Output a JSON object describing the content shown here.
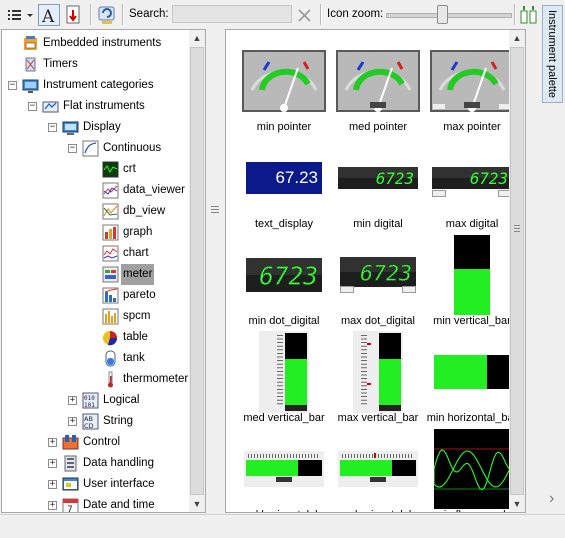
{
  "toolbar": {
    "search_label": "Search:",
    "search_value": "",
    "zoom_label": "Icon zoom:",
    "zoom_level": 0.45,
    "icons": [
      "list-view-icon",
      "font-icon",
      "sort-icon",
      "refresh-icon",
      "clear-icon",
      "palette-layout-icon"
    ]
  },
  "tree": {
    "items": [
      {
        "label": "Embedded instruments",
        "icon": "embedded-instruments-icon"
      },
      {
        "label": "Timers",
        "icon": "timers-icon"
      },
      {
        "label": "Instrument categories",
        "icon": "categories-icon",
        "expander": "-"
      },
      {
        "label": "Flat instruments",
        "icon": "flat-instruments-icon",
        "expander": "-"
      },
      {
        "label": "Display",
        "icon": "display-icon",
        "expander": "-"
      },
      {
        "label": "Continuous",
        "icon": "continuous-icon",
        "expander": "-"
      },
      {
        "label": "crt",
        "icon": "crt-icon"
      },
      {
        "label": "data_viewer",
        "icon": "data-viewer-icon"
      },
      {
        "label": "db_view",
        "icon": "db-view-icon"
      },
      {
        "label": "graph",
        "icon": "graph-icon"
      },
      {
        "label": "chart",
        "icon": "chart-icon"
      },
      {
        "label": "meter",
        "icon": "meter-icon",
        "selected": true
      },
      {
        "label": "pareto",
        "icon": "pareto-icon"
      },
      {
        "label": "spcm",
        "icon": "spcm-icon"
      },
      {
        "label": "table",
        "icon": "table-icon"
      },
      {
        "label": "tank",
        "icon": "tank-icon"
      },
      {
        "label": "thermometer",
        "icon": "thermometer-icon"
      },
      {
        "label": "Logical",
        "icon": "logical-icon",
        "expander": "+"
      },
      {
        "label": "String",
        "icon": "string-icon",
        "expander": "+"
      },
      {
        "label": "Control",
        "icon": "control-icon",
        "expander": "+"
      },
      {
        "label": "Data handling",
        "icon": "data-handling-icon",
        "expander": "+"
      },
      {
        "label": "User interface",
        "icon": "user-interface-icon",
        "expander": "+"
      },
      {
        "label": "Date and time",
        "icon": "date-time-icon",
        "expander": "+"
      }
    ]
  },
  "palette": {
    "items": [
      {
        "caption": "min pointer",
        "kind": "pointer-min"
      },
      {
        "caption": "med pointer",
        "kind": "pointer-med"
      },
      {
        "caption": "max pointer",
        "kind": "pointer-max"
      },
      {
        "caption": "text_display",
        "kind": "text",
        "value": "67.23"
      },
      {
        "caption": "min digital",
        "kind": "digital-min",
        "value": "6723"
      },
      {
        "caption": "max digital",
        "kind": "digital-max",
        "value": "6723"
      },
      {
        "caption": "min dot_digital",
        "kind": "dot-min",
        "value": "6723"
      },
      {
        "caption": "max dot_digital",
        "kind": "dot-max",
        "value": "6723"
      },
      {
        "caption": "min vertical_bar",
        "kind": "vbar-min"
      },
      {
        "caption": "med vertical_bar",
        "kind": "vbar-med"
      },
      {
        "caption": "max vertical_bar",
        "kind": "vbar-max"
      },
      {
        "caption": "min horizontal_bar",
        "kind": "hbar-min"
      },
      {
        "caption": "med horizontal_bar",
        "kind": "hbar-med"
      },
      {
        "caption": "max horizontal_bar",
        "kind": "hbar-max"
      },
      {
        "caption": "min flow_graph",
        "kind": "flow"
      }
    ]
  },
  "side_tab": {
    "label": "Instrument palette"
  },
  "colors": {
    "accent_green": "#22ee22",
    "lcd_blue": "#0a1a8a",
    "selection": "#a0a0a0"
  }
}
